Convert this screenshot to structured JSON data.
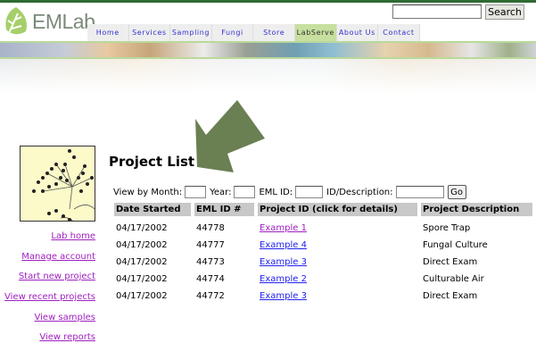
{
  "header": {
    "logo_text": "EMLab",
    "search_placeholder": "",
    "search_button": "Search"
  },
  "nav": {
    "tabs": [
      {
        "label": "Home"
      },
      {
        "label": "Services"
      },
      {
        "label": "Sampling"
      },
      {
        "label": "Fungi"
      },
      {
        "label": "Store"
      },
      {
        "label": "LabServe",
        "active": true
      },
      {
        "label": "About Us"
      },
      {
        "label": "Contact"
      }
    ]
  },
  "colors": {
    "brand_green": "#2f6b33",
    "arrow": "#6a7f52",
    "link": "#2222ee",
    "visited": "#a020c0",
    "active_tab": "#c7df9f"
  },
  "sidebar": {
    "links": [
      {
        "label": "Lab home"
      },
      {
        "label": "Manage account"
      },
      {
        "label": "Start new project"
      },
      {
        "label": "View recent projects"
      },
      {
        "label": "View samples"
      },
      {
        "label": "View reports"
      }
    ]
  },
  "main": {
    "title": "Project List",
    "filter": {
      "month_label": "View by Month:",
      "year_label": "Year:",
      "emlid_label": "EML ID:",
      "desc_label": "ID/Description:",
      "go": "Go",
      "month": "",
      "year": "",
      "emlid": "",
      "desc": ""
    },
    "table": {
      "headers": [
        "Date Started",
        "EML ID #",
        "Project ID (click for details)",
        "Project Description"
      ],
      "rows": [
        {
          "date": "04/17/2002",
          "emlid": "44778",
          "project": "Example 1",
          "desc": "Spore Trap"
        },
        {
          "date": "04/17/2002",
          "emlid": "44777",
          "project": "Example 4",
          "desc": "Fungal Culture"
        },
        {
          "date": "04/17/2002",
          "emlid": "44773",
          "project": "Example 3",
          "desc": "Direct Exam"
        },
        {
          "date": "04/17/2002",
          "emlid": "44774",
          "project": "Example 2",
          "desc": "Culturable Air"
        },
        {
          "date": "04/17/2002",
          "emlid": "44772",
          "project": "Example 3",
          "desc": "Direct Exam"
        }
      ]
    }
  }
}
